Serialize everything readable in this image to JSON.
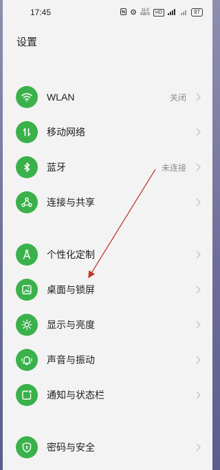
{
  "statusbar": {
    "time": "17:45",
    "speed_value": "11.0",
    "speed_unit": "KB/S",
    "hd_badge": "HD",
    "battery": "97"
  },
  "page_title": "设置",
  "settings": [
    {
      "label": "WLAN",
      "value": "关闭",
      "icon": "wifi-icon"
    },
    {
      "label": "移动网络",
      "value": "",
      "icon": "mobile-data-icon"
    },
    {
      "label": "蓝牙",
      "value": "未连接",
      "icon": "bluetooth-icon"
    },
    {
      "label": "连接与共享",
      "value": "",
      "icon": "share-icon"
    },
    {
      "label": "个性化定制",
      "value": "",
      "icon": "personalize-icon"
    },
    {
      "label": "桌面与锁屏",
      "value": "",
      "icon": "wallpaper-icon"
    },
    {
      "label": "显示与亮度",
      "value": "",
      "icon": "brightness-icon"
    },
    {
      "label": "声音与振动",
      "value": "",
      "icon": "bell-icon"
    },
    {
      "label": "通知与状态栏",
      "value": "",
      "icon": "notification-icon"
    },
    {
      "label": "密码与安全",
      "value": "",
      "icon": "shield-icon"
    }
  ],
  "colors": {
    "accent": "#3ab14a",
    "annotation_arrow": "#c0392b"
  }
}
